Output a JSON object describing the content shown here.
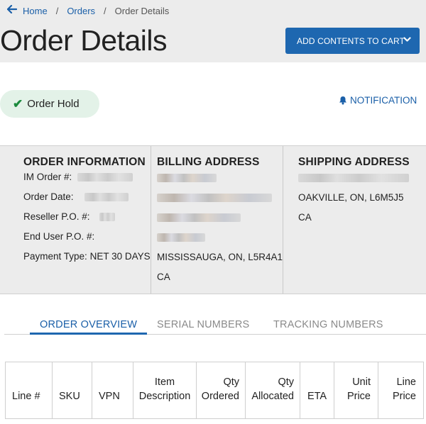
{
  "breadcrumb": {
    "items": [
      "Home",
      "Orders",
      "Order Details"
    ],
    "separator": "/"
  },
  "page_title": "Order Details",
  "cart_button_label": "ADD CONTENTS TO CART",
  "status_pill": "Order Hold",
  "notification_label": "NOTIFICATION",
  "order_information": {
    "heading": "ORDER INFORMATION",
    "im_order_label": "IM Order #:",
    "order_date_label": "Order Date:",
    "reseller_po_label": "Reseller P.O. #:",
    "end_user_po_label": "End User P.O. #:",
    "payment_type_label": "Payment Type:",
    "payment_type_value": "NET 30 DAYS"
  },
  "billing_address": {
    "heading": "BILLING ADDRESS",
    "city_line": "MISSISSAUGA, ON, L5R4A1",
    "country": "CA"
  },
  "shipping_address": {
    "heading": "SHIPPING ADDRESS",
    "city_line": "OAKVILLE, ON, L6M5J5",
    "country": "CA"
  },
  "tabs": [
    "ORDER OVERVIEW",
    "SERIAL NUMBERS",
    "TRACKING NUMBERS"
  ],
  "active_tab": "ORDER OVERVIEW",
  "table": {
    "columns": [
      {
        "line1": "",
        "line2": "Line #"
      },
      {
        "line1": "",
        "line2": "SKU"
      },
      {
        "line1": "",
        "line2": "VPN"
      },
      {
        "line1": "Item",
        "line2": "Description"
      },
      {
        "line1": "Qty",
        "line2": "Ordered"
      },
      {
        "line1": "Qty",
        "line2": "Allocated"
      },
      {
        "line1": "",
        "line2": "ETA"
      },
      {
        "line1": "Unit",
        "line2": "Price"
      },
      {
        "line1": "Line",
        "line2": "Price"
      }
    ]
  },
  "colors": {
    "accent": "#1e67b0",
    "link": "#1a5fa8",
    "hold_pill_bg": "#e3f2e8",
    "check": "#1a8a3c",
    "panel_bg": "#ececec"
  },
  "icons": {
    "back": "arrow-left-icon",
    "chevron": "chevron-down-icon",
    "check": "check-icon",
    "bell": "bell-icon"
  }
}
